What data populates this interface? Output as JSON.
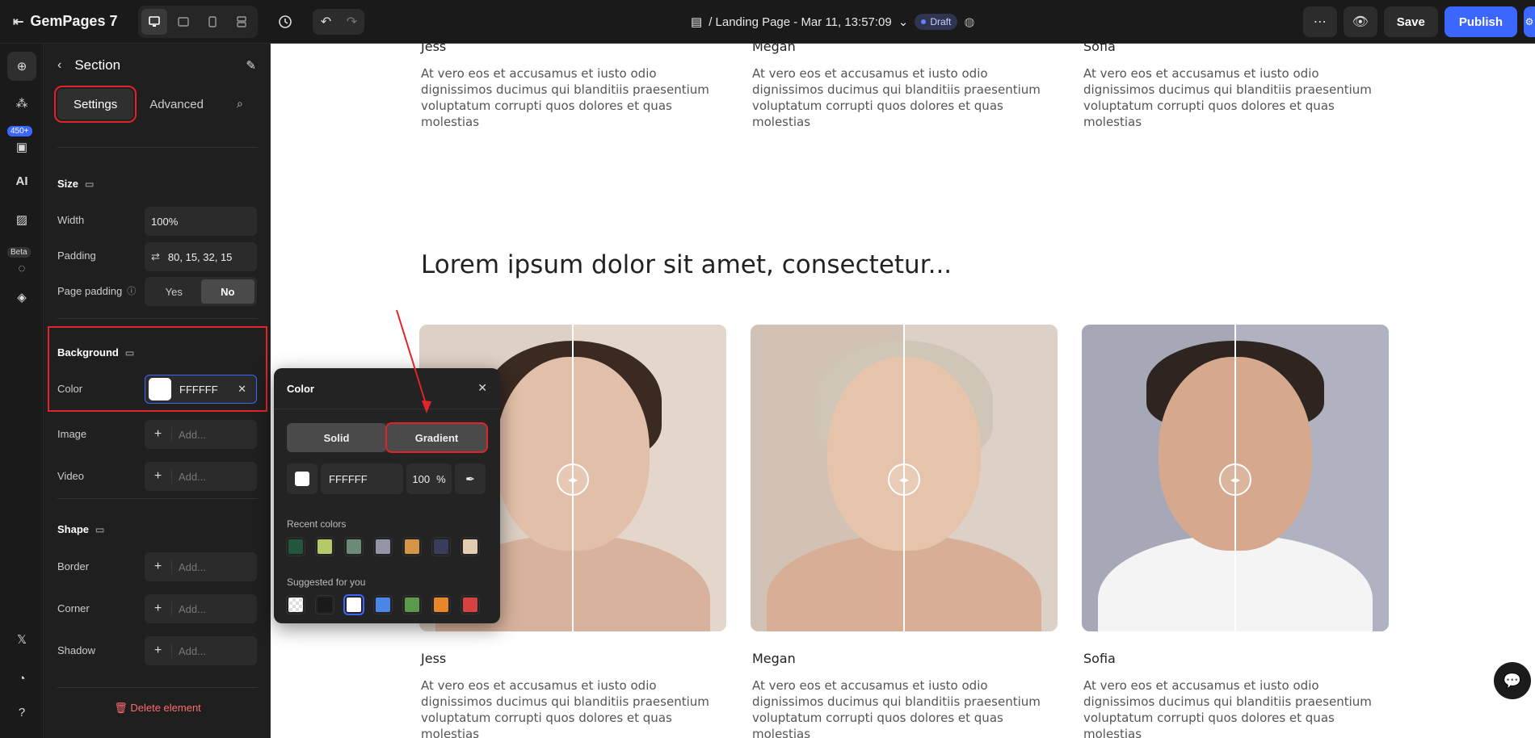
{
  "topbar": {
    "app_name": "GemPages 7",
    "page_title": "/ Landing Page - Mar 11, 13:57:09",
    "status_badge": "Draft",
    "save_label": "Save",
    "publish_label": "Publish"
  },
  "rail": {
    "count_badge": "450+",
    "beta_badge": "Beta",
    "ai_label": "AI"
  },
  "panel": {
    "title": "Section",
    "tabs": [
      "Settings",
      "Advanced"
    ],
    "size": {
      "title": "Size",
      "width_label": "Width",
      "width_value": "100%",
      "padding_label": "Padding",
      "padding_value": "80, 15, 32, 15",
      "page_padding_label": "Page padding",
      "page_padding_options": [
        "Yes",
        "No"
      ],
      "page_padding_selected": "No"
    },
    "background": {
      "title": "Background",
      "color_label": "Color",
      "color_value": "FFFFFF",
      "image_label": "Image",
      "video_label": "Video",
      "add_placeholder": "Add..."
    },
    "shape": {
      "title": "Shape",
      "border_label": "Border",
      "corner_label": "Corner",
      "shadow_label": "Shadow",
      "add_placeholder": "Add..."
    },
    "delete_label": "Delete element"
  },
  "canvas": {
    "top_people": [
      {
        "name": "Jess",
        "desc": "At vero eos et accusamus et iusto odio dignissimos ducimus qui blanditiis praesentium voluptatum corrupti quos dolores et quas molestias"
      },
      {
        "name": "Megan",
        "desc": "At vero eos et accusamus et iusto odio dignissimos ducimus qui blanditiis praesentium voluptatum corrupti quos dolores et quas molestias"
      },
      {
        "name": "Sofia",
        "desc": "At vero eos et accusamus et iusto odio dignissimos ducimus qui blanditiis praesentium voluptatum corrupti quos dolores et quas molestias"
      }
    ],
    "headline": "Lorem ipsum dolor sit amet, consectetur...",
    "bottom_people": [
      {
        "name": "Jess",
        "desc": "At vero eos et accusamus et iusto odio dignissimos ducimus qui blanditiis praesentium voluptatum corrupti quos dolores et quas molestias"
      },
      {
        "name": "Megan",
        "desc": "At vero eos et accusamus et iusto odio dignissimos ducimus qui blanditiis praesentium voluptatum corrupti quos dolores et quas molestias"
      },
      {
        "name": "Sofia",
        "desc": "At vero eos et accusamus et iusto odio dignissimos ducimus qui blanditiis praesentium voluptatum corrupti quos dolores et quas molestias"
      }
    ]
  },
  "color_popup": {
    "title": "Color",
    "tabs": [
      "Solid",
      "Gradient"
    ],
    "hex_value": "FFFFFF",
    "opacity_value": "100",
    "opacity_unit": "%",
    "recent_label": "Recent colors",
    "recent_colors": [
      "#23553f",
      "#b6c96a",
      "#6d8a79",
      "#9494a8",
      "#d69447",
      "#3a3c5c",
      "#e3cdb1"
    ],
    "suggested_label": "Suggested for you",
    "suggested_colors": [
      "transparent",
      "#1a1a1a",
      "#ffffff",
      "#4a86e8",
      "#5a9a4a",
      "#e8862a",
      "#d64141"
    ],
    "suggested_selected": "#ffffff"
  },
  "colors": {
    "accent": "#3c67ff",
    "highlight": "#e0242a",
    "delete": "#ff6b6b"
  }
}
